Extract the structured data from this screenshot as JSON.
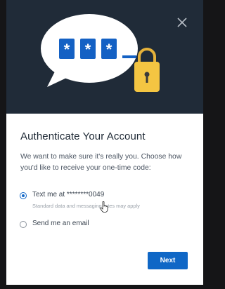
{
  "modal": {
    "title": "Authenticate Your Account",
    "description": "We want to make sure it's really you. Choose how you'd like to receive your one-time code:",
    "close_icon": "close-icon",
    "illustration": {
      "masked_characters": [
        "*",
        "*",
        "*"
      ],
      "icon": "password-lock-icon"
    },
    "options": [
      {
        "label": "Text me at ********0049",
        "sublabel": "Standard data and messaging rates may apply",
        "selected": true
      },
      {
        "label": "Send me an email",
        "selected": false
      }
    ],
    "next_label": "Next"
  },
  "colors": {
    "hero_background": "#202b38",
    "accent": "#0f67c6",
    "lock": "#f4c542"
  }
}
